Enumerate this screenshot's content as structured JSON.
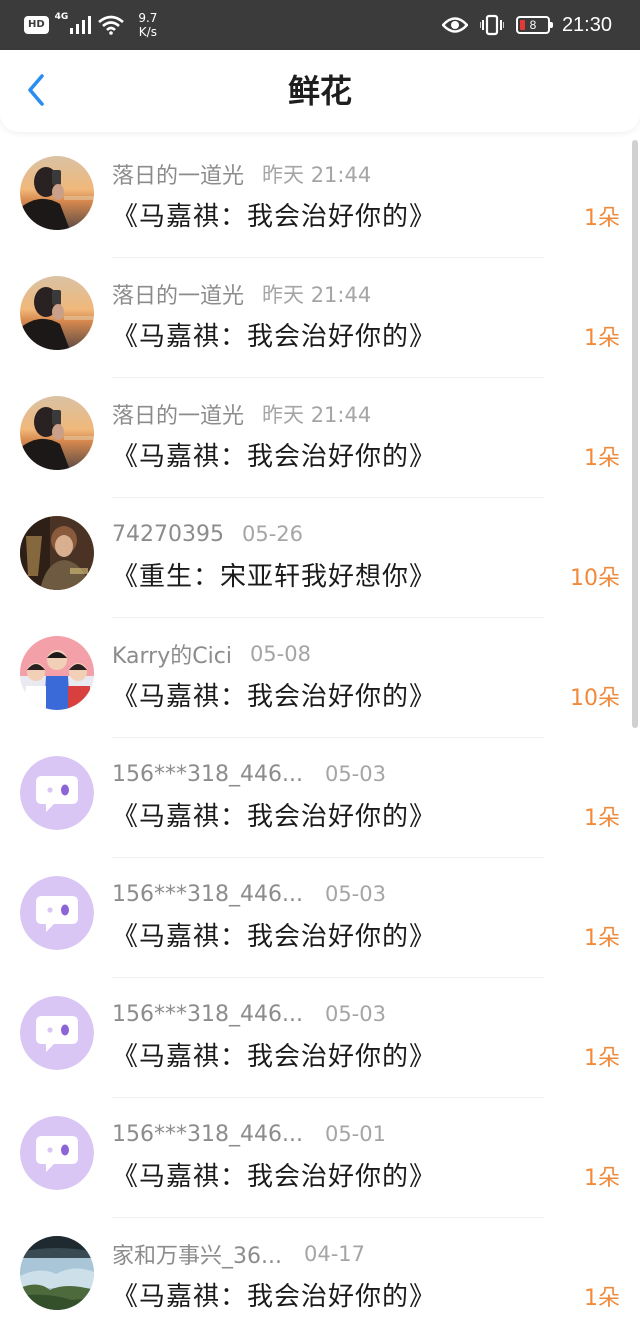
{
  "status_bar": {
    "hd": "HD",
    "network": "4G",
    "speed_value": "9.7",
    "speed_unit": "K/s",
    "battery": "8",
    "time": "21:30",
    "icons": [
      "signal-icon",
      "wifi-icon",
      "eye-icon",
      "vibrate-icon",
      "battery-icon"
    ]
  },
  "header": {
    "title": "鲜花",
    "back_icon": "chevron-left-icon",
    "accent_color": "#2a8ef0"
  },
  "flowers": [
    {
      "name": "落日的一道光",
      "time": "昨天 21:44",
      "book": "《马嘉祺：我会治好你的》",
      "count": "1朵",
      "avatar": "photo-sunset"
    },
    {
      "name": "落日的一道光",
      "time": "昨天 21:44",
      "book": "《马嘉祺：我会治好你的》",
      "count": "1朵",
      "avatar": "photo-sunset"
    },
    {
      "name": "落日的一道光",
      "time": "昨天 21:44",
      "book": "《马嘉祺：我会治好你的》",
      "count": "1朵",
      "avatar": "photo-sunset"
    },
    {
      "name": "74270395",
      "time": "05-26",
      "book": "《重生：宋亚轩我好想你》",
      "count": "10朵",
      "avatar": "photo-person"
    },
    {
      "name": "Karry的Cici",
      "time": "05-08",
      "book": "《马嘉祺：我会治好你的》",
      "count": "10朵",
      "avatar": "photo-group"
    },
    {
      "name": "156***318_446...",
      "time": "05-03",
      "book": "《马嘉祺：我会治好你的》",
      "count": "1朵",
      "avatar": "default-chat"
    },
    {
      "name": "156***318_446...",
      "time": "05-03",
      "book": "《马嘉祺：我会治好你的》",
      "count": "1朵",
      "avatar": "default-chat"
    },
    {
      "name": "156***318_446...",
      "time": "05-03",
      "book": "《马嘉祺：我会治好你的》",
      "count": "1朵",
      "avatar": "default-chat"
    },
    {
      "name": "156***318_446...",
      "time": "05-01",
      "book": "《马嘉祺：我会治好你的》",
      "count": "1朵",
      "avatar": "default-chat"
    },
    {
      "name": "家和万事兴_36...",
      "time": "04-17",
      "book": "《马嘉祺：我会治好你的》",
      "count": "1朵",
      "avatar": "photo-landscape"
    }
  ],
  "colors": {
    "count": "#f08a3c",
    "name": "#8c8c8c",
    "default_avatar": "#d9c6f5"
  }
}
